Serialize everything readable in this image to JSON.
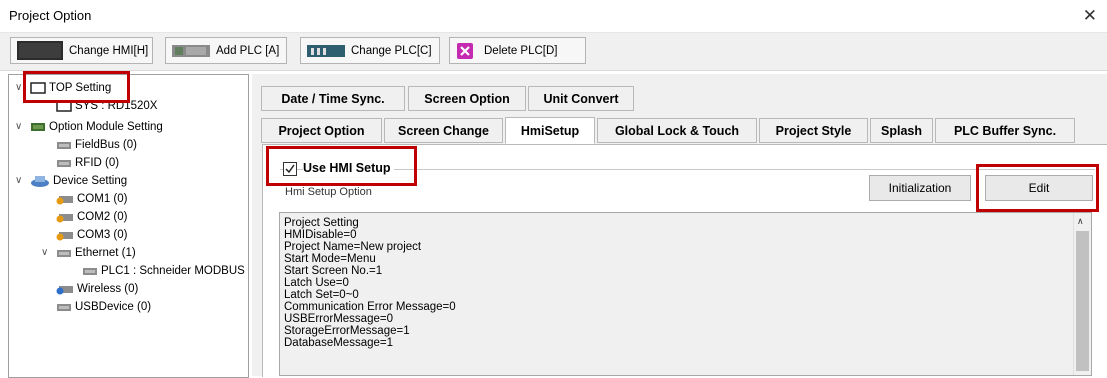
{
  "window": {
    "title": "Project Option",
    "close_glyph": "✕"
  },
  "toolbar": {
    "buttons": [
      {
        "label": "Change HMI[H]",
        "icon": "hmi-screen-icon"
      },
      {
        "label": "Add PLC [A]",
        "icon": "plc-add-icon"
      },
      {
        "label": "Change PLC[C]",
        "icon": "plc-change-icon"
      },
      {
        "label": "Delete PLC[D]",
        "icon": "delete-icon"
      }
    ]
  },
  "tree": {
    "items": [
      {
        "label": "TOP Setting",
        "icon": "monitor-icon"
      },
      {
        "label": "SYS : RD1520X",
        "icon": "monitor-icon"
      },
      {
        "label": "Option Module Setting",
        "icon": "module-icon"
      },
      {
        "label": "FieldBus (0)",
        "icon": "device-icon"
      },
      {
        "label": "RFID (0)",
        "icon": "device-icon"
      },
      {
        "label": "Device Setting",
        "icon": "device-setting-icon"
      },
      {
        "label": "COM1 (0)",
        "icon": "com-port-icon"
      },
      {
        "label": "COM2 (0)",
        "icon": "com-port-icon"
      },
      {
        "label": "COM3 (0)",
        "icon": "com-port-icon"
      },
      {
        "label": "Ethernet (1)",
        "icon": "device-icon"
      },
      {
        "label": "PLC1 : Schneider MODBUS",
        "icon": "device-icon"
      },
      {
        "label": "Wireless (0)",
        "icon": "wireless-icon"
      },
      {
        "label": "USBDevice (0)",
        "icon": "device-icon"
      }
    ]
  },
  "tabs": {
    "row1": [
      "Date / Time Sync.",
      "Screen Option",
      "Unit Convert"
    ],
    "row2": [
      "Project Option",
      "Screen Change",
      "HmiSetup",
      "Global Lock & Touch",
      "Project Style",
      "Splash",
      "PLC Buffer Sync."
    ],
    "active": "HmiSetup"
  },
  "hmisetup": {
    "use_label": "Use HMI Setup",
    "use_checked": true,
    "option_label": "Hmi Setup Option",
    "initialization_label": "Initialization",
    "edit_label": "Edit",
    "settings_text": [
      "Project Setting",
      "HMIDisable=0",
      "Project Name=New project",
      "Start Mode=Menu",
      "Start Screen No.=1",
      "Latch Use=0",
      "Latch Set=0~0",
      "Communication Error Message=0",
      "USBErrorMessage=0",
      "StorageErrorMessage=1",
      "DatabaseMessage=1"
    ]
  },
  "colors": {
    "highlight": "#c00000",
    "panel_bg": "#f0f0f0"
  }
}
